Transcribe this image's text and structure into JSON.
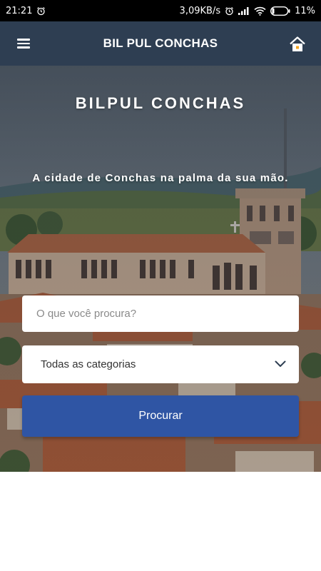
{
  "status_bar": {
    "time": "21:21",
    "network_speed": "3,09KB/s",
    "battery": "11%",
    "icons": [
      "alarm-icon",
      "alarm-icon",
      "signal-icon",
      "wifi-icon",
      "battery-icon"
    ]
  },
  "app_bar": {
    "title": "BIL PUL CONCHAS",
    "menu_icon": "hamburger-menu-icon",
    "home_icon": "home-icon",
    "background": "#2e3e52"
  },
  "hero": {
    "title": "BILPUL CONCHAS",
    "subtitle": "A cidade de Conchas na palma da sua mão.",
    "background_image": "city-church-photo"
  },
  "search": {
    "placeholder": "O que você procura?",
    "value": ""
  },
  "category": {
    "selected": "Todas as categorias",
    "icon": "chevron-down-icon"
  },
  "search_button": {
    "label": "Procurar",
    "color": "#2f55a4"
  }
}
